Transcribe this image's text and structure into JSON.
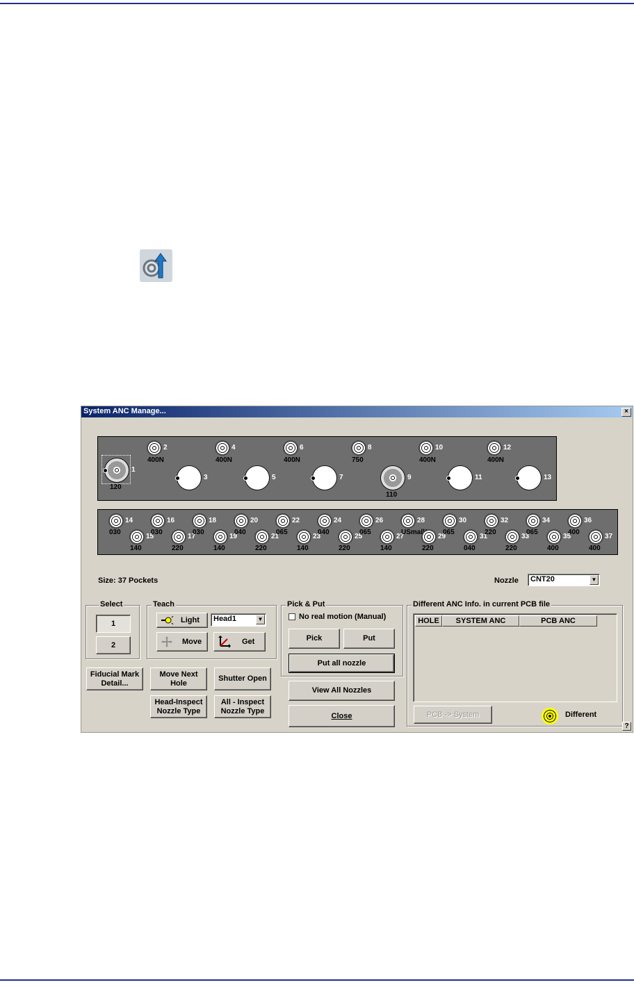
{
  "window": {
    "title": "System ANC Manage...",
    "close_glyph": "×"
  },
  "rack_top": {
    "nozzles": [
      {
        "pos": "1",
        "type": "120",
        "style": "mounted",
        "selected": true
      },
      {
        "pos": "2",
        "type": "400N",
        "style": "small"
      },
      {
        "pos": "3",
        "type": "",
        "style": "empty"
      },
      {
        "pos": "4",
        "type": "400N",
        "style": "small"
      },
      {
        "pos": "5",
        "type": "",
        "style": "empty"
      },
      {
        "pos": "6",
        "type": "400N",
        "style": "small"
      },
      {
        "pos": "7",
        "type": "",
        "style": "empty"
      },
      {
        "pos": "8",
        "type": "750",
        "style": "small"
      },
      {
        "pos": "9",
        "type": "110",
        "style": "mounted"
      },
      {
        "pos": "10",
        "type": "400N",
        "style": "small"
      },
      {
        "pos": "11",
        "type": "",
        "style": "empty"
      },
      {
        "pos": "12",
        "type": "400N",
        "style": "small"
      },
      {
        "pos": "13",
        "type": "",
        "style": "empty"
      }
    ]
  },
  "rack_bottom": {
    "nozzles": [
      {
        "pos": "14",
        "type": "030"
      },
      {
        "pos": "15",
        "type": "140"
      },
      {
        "pos": "16",
        "type": "030"
      },
      {
        "pos": "17",
        "type": "220"
      },
      {
        "pos": "18",
        "type": "030"
      },
      {
        "pos": "19",
        "type": "140"
      },
      {
        "pos": "20",
        "type": "040"
      },
      {
        "pos": "21",
        "type": "220"
      },
      {
        "pos": "22",
        "type": "065"
      },
      {
        "pos": "23",
        "type": "140"
      },
      {
        "pos": "24",
        "type": "040"
      },
      {
        "pos": "25",
        "type": "220"
      },
      {
        "pos": "26",
        "type": "065"
      },
      {
        "pos": "27",
        "type": "140"
      },
      {
        "pos": "28",
        "type": "USmall2"
      },
      {
        "pos": "29",
        "type": "220"
      },
      {
        "pos": "30",
        "type": "065"
      },
      {
        "pos": "31",
        "type": "040"
      },
      {
        "pos": "32",
        "type": "220"
      },
      {
        "pos": "33",
        "type": "220"
      },
      {
        "pos": "34",
        "type": "065"
      },
      {
        "pos": "35",
        "type": "400"
      },
      {
        "pos": "36",
        "type": "400"
      },
      {
        "pos": "37",
        "type": "400"
      }
    ]
  },
  "size_label": "Size: 37 Pockets",
  "nozzle": {
    "label": "Nozzle",
    "value": "CNT20"
  },
  "select": {
    "title": "Select",
    "btn1": "1",
    "btn2": "2"
  },
  "teach": {
    "title": "Teach",
    "light": "Light",
    "head_value": "Head1",
    "move": "Move",
    "get": "Get"
  },
  "pick_put": {
    "title": "Pick & Put",
    "manual_label": "No real motion (Manual)",
    "pick": "Pick",
    "put": "Put",
    "put_all": "Put all nozzle"
  },
  "buttons": {
    "fiducial": "Fiducial Mark Detail...",
    "move_next": "Move Next Hole",
    "shutter": "Shutter Open",
    "head_inspect": "Head-Inspect Nozzle Type",
    "all_inspect": "All - Inspect Nozzle Type",
    "view_all": "View All Nozzles",
    "close": "Close"
  },
  "diff": {
    "title": "Different ANC Info. in current PCB file",
    "columns": [
      "HOLE",
      "SYSTEM ANC",
      "PCB ANC"
    ],
    "pcb_system": "PCB -> System",
    "legend": "Different"
  },
  "help_glyph": "?",
  "colors": {
    "title_start": "#0a246a",
    "title_end": "#a6caf0",
    "dialog_bg": "#d8d3c8",
    "rack_bg": "#6e6e6e",
    "page_rule": "#1f2f8f",
    "different_icon": "#ffff00"
  }
}
